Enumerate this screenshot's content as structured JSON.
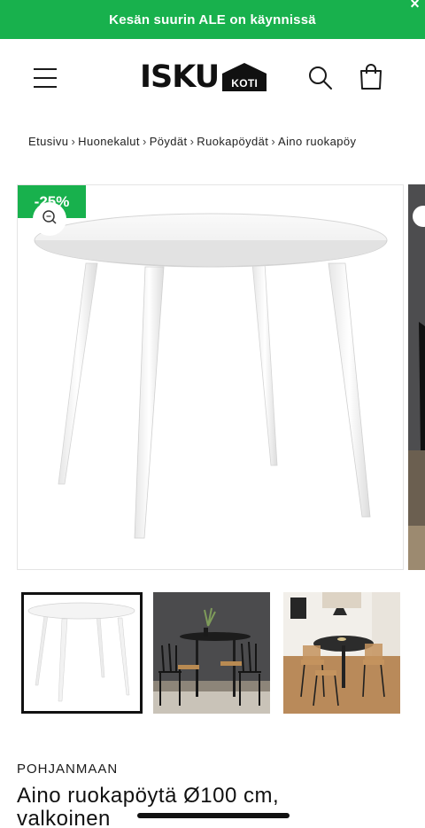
{
  "announcement": {
    "text": "Kesän suurin ALE on käynnissä",
    "close_glyph": "×"
  },
  "header": {
    "logo_word": "ISKU",
    "logo_badge": "KOTI",
    "menu_icon": "hamburger-menu-icon",
    "search_icon": "search-icon",
    "cart_icon": "shopping-bag-icon"
  },
  "breadcrumb": [
    "Etusivu",
    "Huonekalut",
    "Pöydät",
    "Ruokapöydät",
    "Aino ruokapöy"
  ],
  "breadcrumb_separator": "›",
  "gallery": {
    "badge": "-25%",
    "zoom_icon": "zoom-icon",
    "thumbnails": [
      {
        "label": "white-table-thumbnail",
        "active": true
      },
      {
        "label": "black-table-dining-set-thumbnail",
        "active": false
      },
      {
        "label": "room-scene-thumbnail",
        "active": false
      }
    ]
  },
  "product": {
    "vendor": "POHJANMAAN",
    "title_line1": "Aino ruokapöytä Ø100 cm,",
    "title_line2": "valkoinen"
  },
  "colors": {
    "accent_green": "#18b14d",
    "text": "#1a1a1a"
  }
}
